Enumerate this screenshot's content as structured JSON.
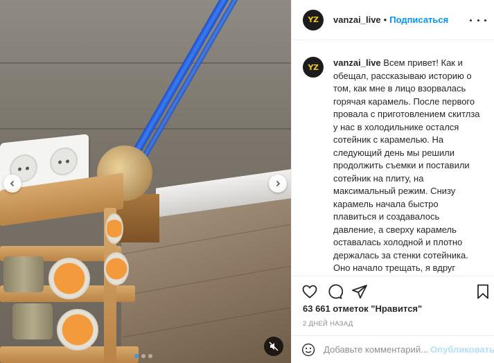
{
  "post": {
    "username": "vanzai_live",
    "avatar_text": "YZ",
    "separator": "•",
    "follow_label": "Подписаться",
    "caption_username": "vanzai_live",
    "caption_text": "Всем привет! Как и обещал, рассказываю историю о том, как мне в лицо взорвалась горячая карамель. После первого провала с приготовлением скитлза у нас в холодильнике остался сотейник с карамелью. На следующий день мы решили продолжить съемки и поставили сотейник на плиту, на максимальный режим. Снизу карамель начала быстро плавиться и создавалось давление, а сверху карамель оставалась холодной и плотно держалась за стенки сотейника. Оно начало трещать, я вдруг решил попробовать температуру пальцем, дотронулся сверху и в эту секунду произошел взрыв. Он был настолько мощный,",
    "likes_text": "63 661 отметок \"Нравится\"",
    "date_text": "2 ДНЕЙ НАЗАД"
  },
  "comment": {
    "placeholder": "Добавьте комментарий...",
    "publish_label": "Опубликовать"
  },
  "carousel": {
    "total": 3,
    "active_index": 0
  },
  "colors": {
    "follow_blue": "#0095f6",
    "publish_disabled": "#b2dffc",
    "cable_blue": "#2f6fe6",
    "active_dot": "#3897f0"
  },
  "icons": [
    "heart-icon",
    "comment-icon",
    "share-icon",
    "bookmark-icon",
    "emoji-icon",
    "mute-icon",
    "chevron-left-icon",
    "chevron-right-icon",
    "more-icon"
  ]
}
